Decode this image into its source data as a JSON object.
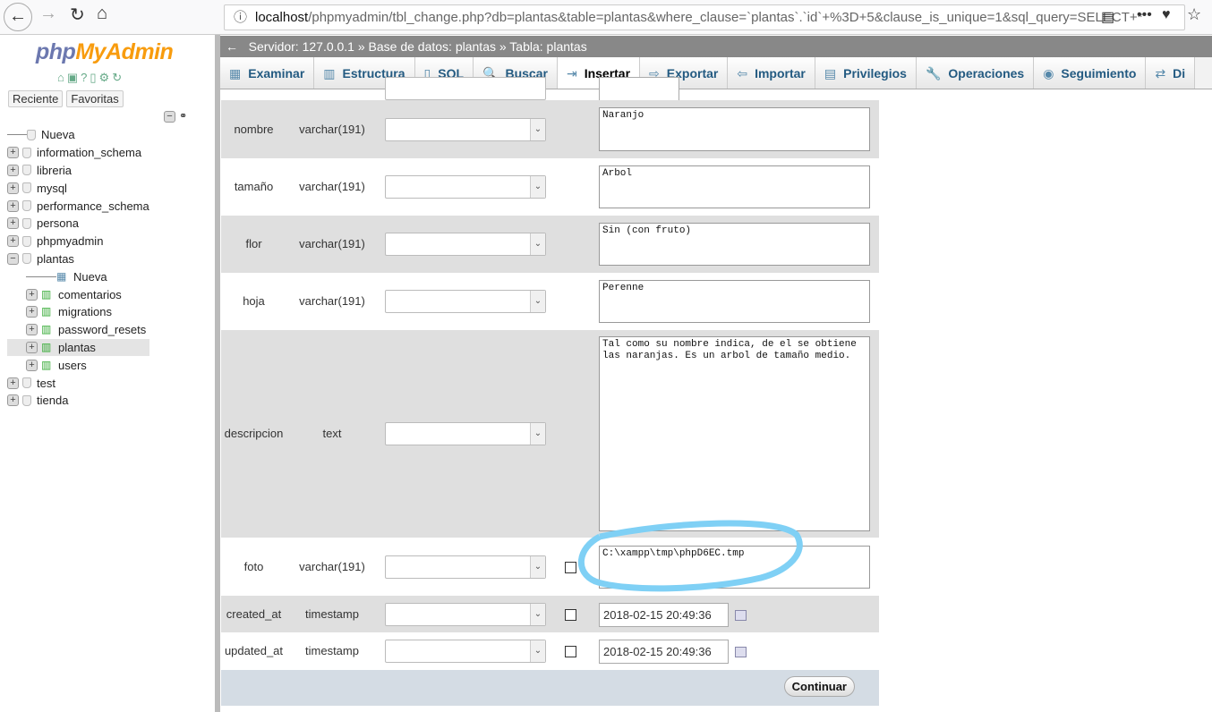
{
  "browser": {
    "url_host": "localhost",
    "url_rest": "/phpmyadmin/tbl_change.php?db=plantas&table=plantas&where_clause=`plantas`.`id`+%3D+5&clause_is_unique=1&sql_query=SELECT+*"
  },
  "sidebar": {
    "logo_php": "php",
    "logo_my": "MyAdmin",
    "tab_recent": "Reciente",
    "tab_fav": "Favoritas",
    "tree": [
      {
        "label": "Nueva",
        "level": 0,
        "kind": "new"
      },
      {
        "label": "information_schema",
        "level": 0
      },
      {
        "label": "libreria",
        "level": 0
      },
      {
        "label": "mysql",
        "level": 0
      },
      {
        "label": "performance_schema",
        "level": 0
      },
      {
        "label": "persona",
        "level": 0
      },
      {
        "label": "phpmyadmin",
        "level": 0
      },
      {
        "label": "plantas",
        "level": 0,
        "expanded": true
      },
      {
        "label": "Nueva",
        "level": 1,
        "kind": "new"
      },
      {
        "label": "comentarios",
        "level": 1
      },
      {
        "label": "migrations",
        "level": 1
      },
      {
        "label": "password_resets",
        "level": 1
      },
      {
        "label": "plantas",
        "level": 1,
        "selected": true
      },
      {
        "label": "users",
        "level": 1
      },
      {
        "label": "test",
        "level": 0
      },
      {
        "label": "tienda",
        "level": 0
      }
    ]
  },
  "breadcrumb": {
    "server": "Servidor: 127.0.0.1",
    "db": "Base de datos: plantas",
    "table": "Tabla: plantas"
  },
  "tabs": [
    "Examinar",
    "Estructura",
    "SQL",
    "Buscar",
    "Insertar",
    "Exportar",
    "Importar",
    "Privilegios",
    "Operaciones",
    "Seguimiento",
    "Di"
  ],
  "active_tab": "Insertar",
  "fields": [
    {
      "name": "nombre",
      "type": "varchar(191)",
      "value": "Naranjo"
    },
    {
      "name": "tamaño",
      "type": "varchar(191)",
      "value": "Arbol"
    },
    {
      "name": "flor",
      "type": "varchar(191)",
      "value": "Sin (con fruto)"
    },
    {
      "name": "hoja",
      "type": "varchar(191)",
      "value": "Perenne"
    },
    {
      "name": "descripcion",
      "type": "text",
      "value": "Tal como su nombre indica, de el se obtiene las naranjas. Es un arbol de tamaño medio."
    },
    {
      "name": "foto",
      "type": "varchar(191)",
      "value": "C:\\xampp\\tmp\\phpD6EC.tmp"
    },
    {
      "name": "created_at",
      "type": "timestamp",
      "value": "2018-02-15 20:49:36"
    },
    {
      "name": "updated_at",
      "type": "timestamp",
      "value": "2018-02-15 20:49:36"
    }
  ],
  "submit": "Continuar",
  "highlight_color": "#7fd0f5"
}
